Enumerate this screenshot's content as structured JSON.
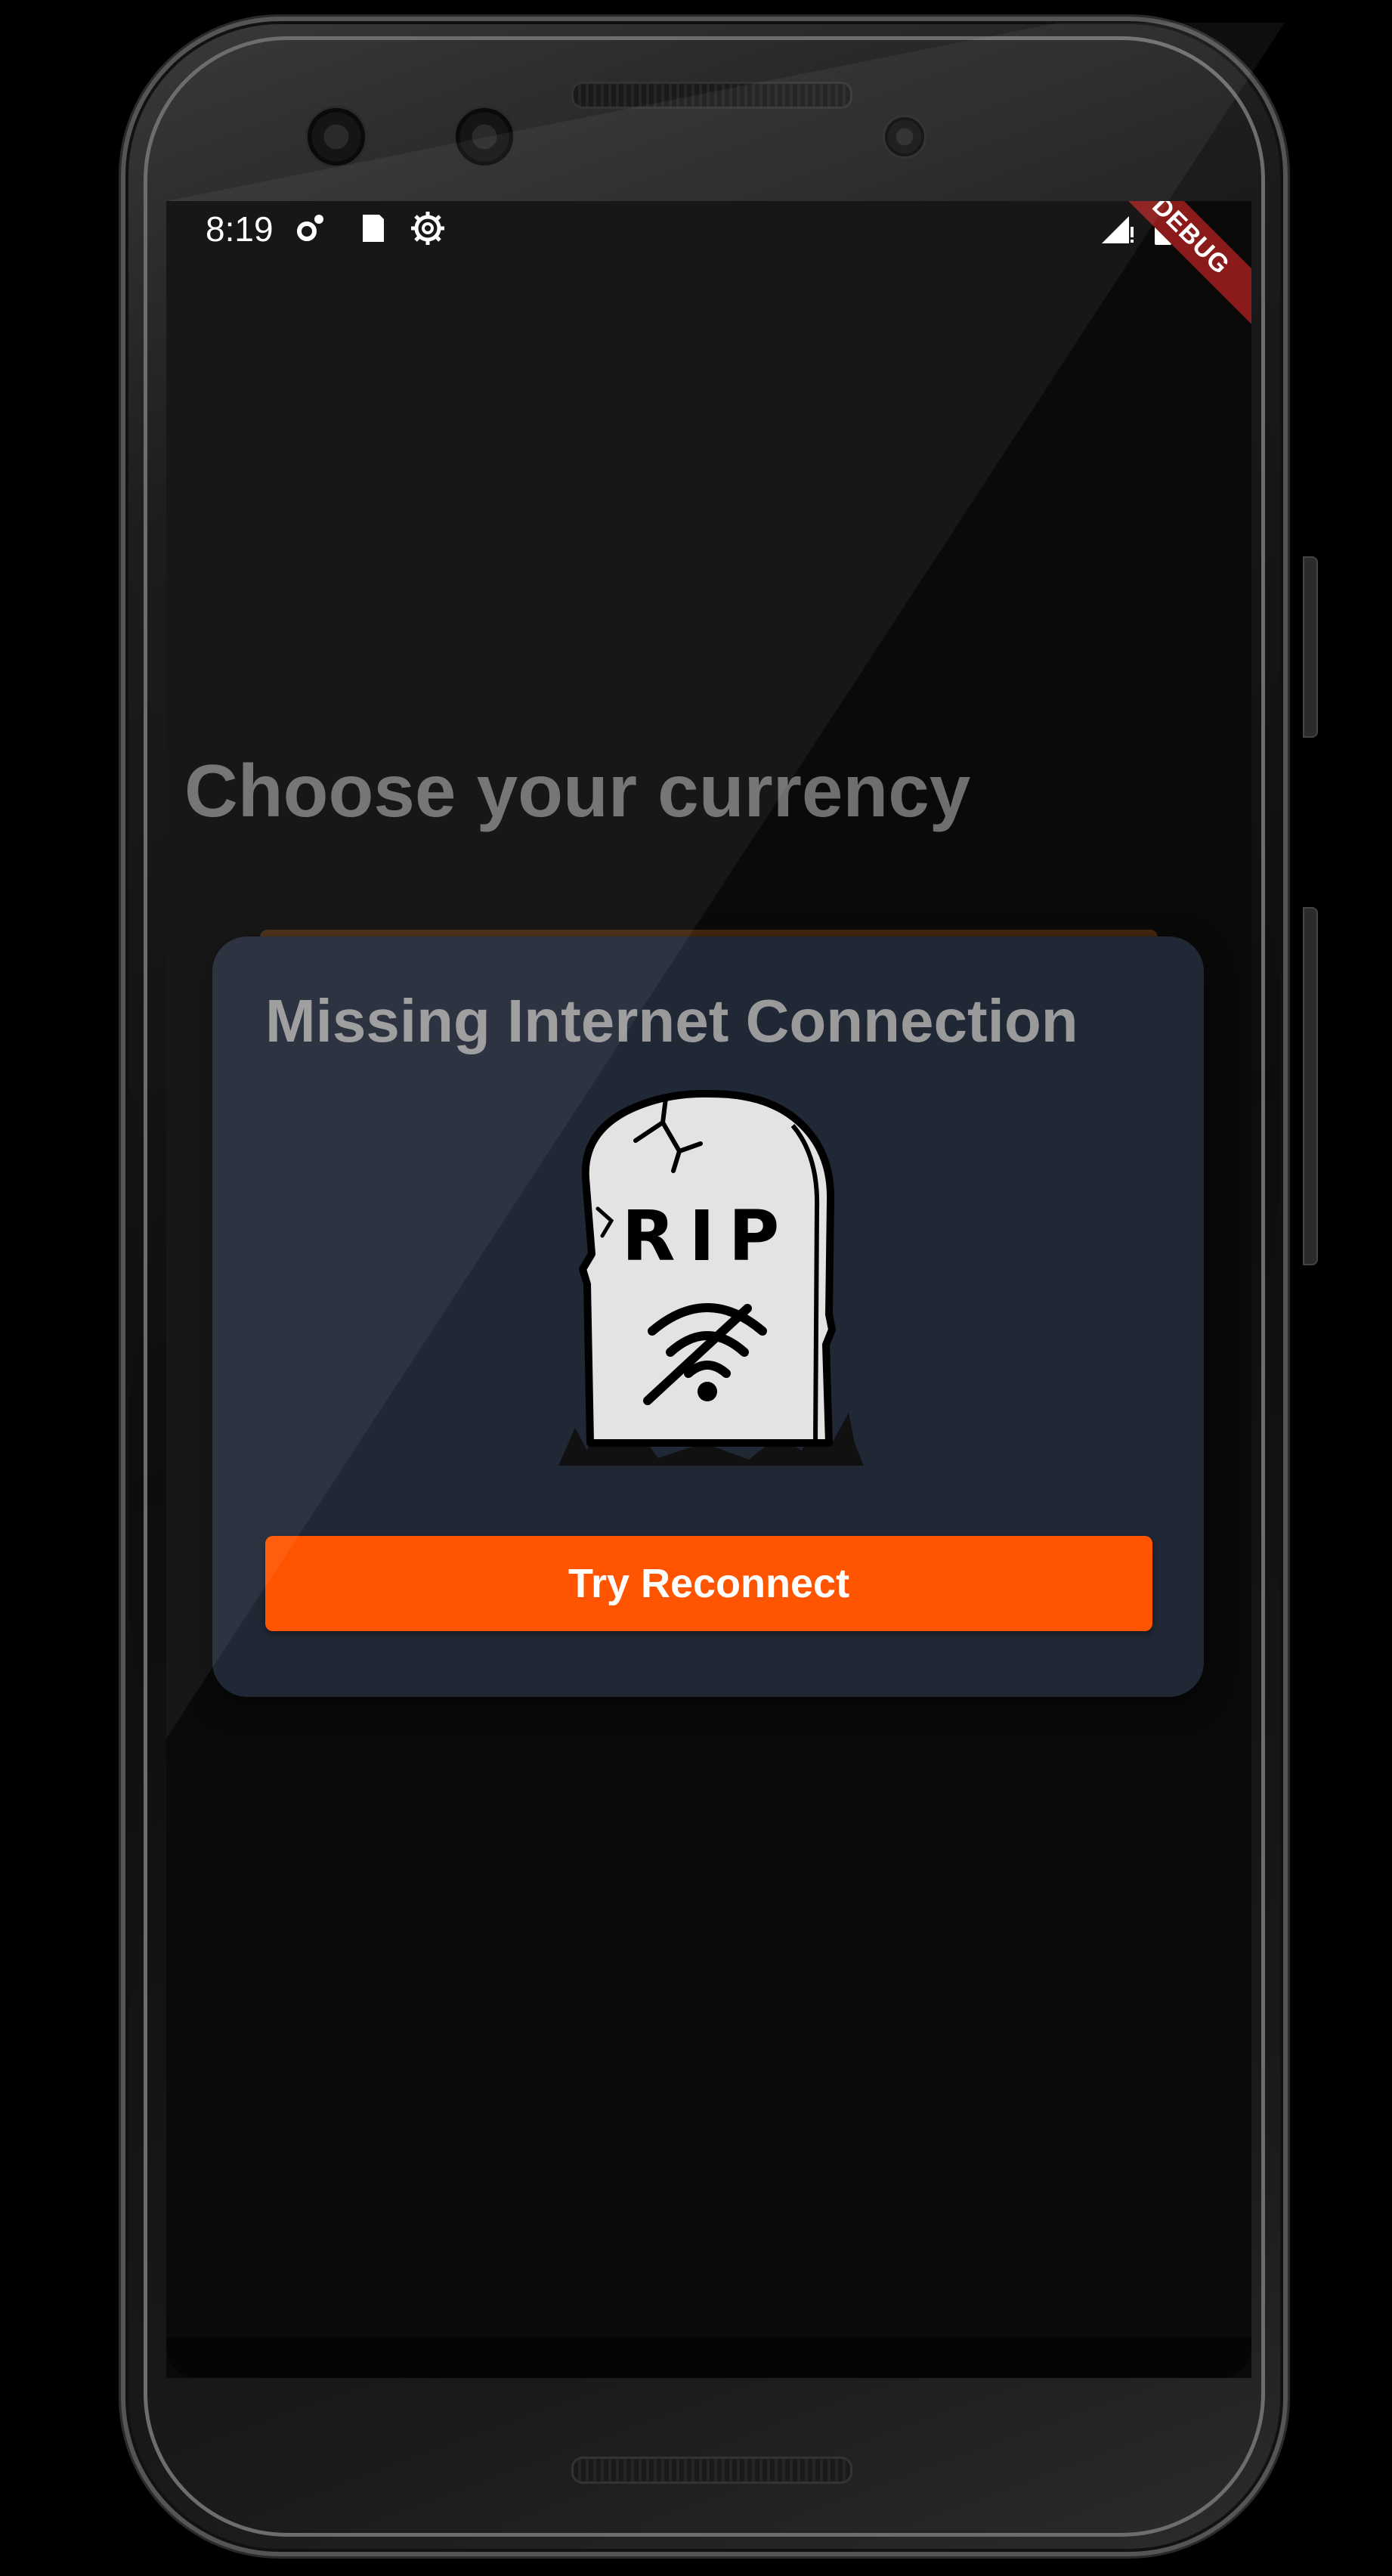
{
  "status_bar": {
    "time": "8:19",
    "icons_left": [
      "settings-gear-icon",
      "sd-card-icon",
      "sync-gear-icon"
    ],
    "icons_right": [
      "signal-no-connection-icon",
      "battery-icon"
    ]
  },
  "debug_banner": {
    "label": "DEBUG"
  },
  "page": {
    "title": "Choose your currency"
  },
  "dialog": {
    "title": "Missing Internet Connection",
    "illustration": {
      "icon": "tombstone-no-wifi-icon",
      "engraving": "RIP"
    },
    "button_label": "Try Reconnect"
  },
  "colors": {
    "accent": "#ff5500",
    "dialog_background": "#212835",
    "screen_background": "#0a0a0a",
    "debug_banner": "#8b1a1a"
  }
}
